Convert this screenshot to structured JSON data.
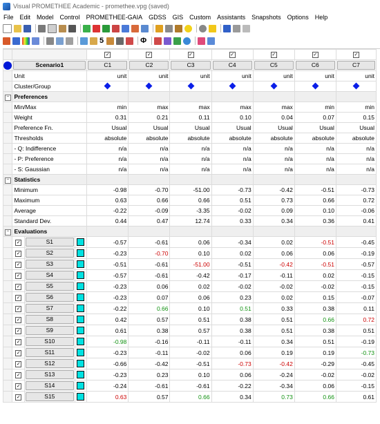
{
  "window": {
    "title": "Visual PROMETHEE Academic - promethee.vpg (saved)"
  },
  "menu": [
    "File",
    "Edit",
    "Model",
    "Control",
    "PROMETHEE-GAIA",
    "GDSS",
    "GIS",
    "Custom",
    "Assistants",
    "Snapshots",
    "Options",
    "Help"
  ],
  "toolbar": {
    "five_label": "5",
    "phi_label": "Φ"
  },
  "colors": {
    "criteria_color": "#0018d8",
    "action_color": "#00e2e2",
    "negative_text": "#cc0000",
    "positive_text": "#119111"
  },
  "grid": {
    "scenario": "Scenario1",
    "criteria": [
      "C1",
      "C2",
      "C3",
      "C4",
      "C5",
      "C6",
      "C7"
    ],
    "unit_row": {
      "label": "Unit",
      "values": [
        "unit",
        "unit",
        "unit",
        "unit",
        "unit",
        "unit",
        "unit"
      ]
    },
    "cluster_row": {
      "label": "Cluster/Group"
    },
    "sections": {
      "preferences": {
        "title": "Preferences",
        "rows": [
          {
            "label": "Min/Max",
            "values": [
              "min",
              "max",
              "max",
              "max",
              "max",
              "min",
              "min"
            ]
          },
          {
            "label": "Weight",
            "values": [
              "0.31",
              "0.21",
              "0.11",
              "0.10",
              "0.04",
              "0.07",
              "0.15"
            ]
          },
          {
            "label": "Preference Fn.",
            "values": [
              "Usual",
              "Usual",
              "Usual",
              "Usual",
              "Usual",
              "Usual",
              "Usual"
            ]
          },
          {
            "label": "Thresholds",
            "values": [
              "absolute",
              "absolute",
              "absolute",
              "absolute",
              "absolute",
              "absolute",
              "absolute"
            ]
          },
          {
            "label": "- Q: Indifference",
            "values": [
              "n/a",
              "n/a",
              "n/a",
              "n/a",
              "n/a",
              "n/a",
              "n/a"
            ]
          },
          {
            "label": "- P: Preference",
            "values": [
              "n/a",
              "n/a",
              "n/a",
              "n/a",
              "n/a",
              "n/a",
              "n/a"
            ]
          },
          {
            "label": "- S: Gaussian",
            "values": [
              "n/a",
              "n/a",
              "n/a",
              "n/a",
              "n/a",
              "n/a",
              "n/a"
            ]
          }
        ]
      },
      "statistics": {
        "title": "Statistics",
        "rows": [
          {
            "label": "Minimum",
            "values": [
              "-0.98",
              "-0.70",
              "-51.00",
              "-0.73",
              "-0.42",
              "-0.51",
              "-0.73"
            ]
          },
          {
            "label": "Maximum",
            "values": [
              "0.63",
              "0.66",
              "0.66",
              "0.51",
              "0.73",
              "0.66",
              "0.72"
            ]
          },
          {
            "label": "Average",
            "values": [
              "-0.22",
              "-0.09",
              "-3.35",
              "-0.02",
              "0.09",
              "0.10",
              "-0.06"
            ]
          },
          {
            "label": "Standard Dev.",
            "values": [
              "0.44",
              "0.47",
              "12.74",
              "0.33",
              "0.34",
              "0.36",
              "0.41"
            ]
          }
        ]
      },
      "evaluations": {
        "title": "Evaluations",
        "rows": [
          {
            "name": "S1",
            "values": [
              "-0.57",
              "-0.61",
              "0.06",
              "-0.34",
              "0.02",
              "-0.51",
              "-0.45"
            ],
            "colors": [
              "",
              "",
              "",
              "",
              "",
              "red",
              ""
            ]
          },
          {
            "name": "S2",
            "values": [
              "-0.23",
              "-0.70",
              "0.10",
              "0.02",
              "0.06",
              "0.06",
              "-0.19"
            ],
            "colors": [
              "",
              "red",
              "",
              "",
              "",
              "",
              ""
            ]
          },
          {
            "name": "S3",
            "values": [
              "-0.51",
              "-0.61",
              "-51.00",
              "-0.51",
              "-0.42",
              "-0.51",
              "-0.57"
            ],
            "colors": [
              "",
              "",
              "red",
              "",
              "red",
              "red",
              ""
            ]
          },
          {
            "name": "S4",
            "values": [
              "-0.57",
              "-0.61",
              "-0.42",
              "-0.17",
              "-0.11",
              "0.02",
              "-0.15"
            ],
            "colors": [
              "",
              "",
              "",
              "",
              "",
              "",
              ""
            ]
          },
          {
            "name": "S5",
            "values": [
              "-0.23",
              "0.06",
              "0.02",
              "-0.02",
              "-0.02",
              "-0.02",
              "-0.15"
            ],
            "colors": [
              "",
              "",
              "",
              "",
              "",
              "",
              ""
            ]
          },
          {
            "name": "S6",
            "values": [
              "-0.23",
              "0.07",
              "0.06",
              "0.23",
              "0.02",
              "0.15",
              "-0.07"
            ],
            "colors": [
              "",
              "",
              "",
              "",
              "",
              "",
              ""
            ]
          },
          {
            "name": "S7",
            "values": [
              "-0.22",
              "0.66",
              "0.10",
              "0.51",
              "0.33",
              "0.38",
              "0.11"
            ],
            "colors": [
              "",
              "green",
              "",
              "green",
              "",
              "",
              ""
            ]
          },
          {
            "name": "S8",
            "values": [
              "0.42",
              "0.57",
              "0.51",
              "0.38",
              "0.51",
              "0.66",
              "0.72"
            ],
            "colors": [
              "",
              "",
              "",
              "",
              "",
              "green",
              "red"
            ]
          },
          {
            "name": "S9",
            "values": [
              "0.61",
              "0.38",
              "0.57",
              "0.38",
              "0.51",
              "0.38",
              "0.51"
            ],
            "colors": [
              "",
              "",
              "",
              "",
              "",
              "",
              ""
            ]
          },
          {
            "name": "S10",
            "values": [
              "-0.98",
              "-0.16",
              "-0.11",
              "-0.11",
              "0.34",
              "0.51",
              "-0.19"
            ],
            "colors": [
              "green",
              "",
              "",
              "",
              "",
              "",
              ""
            ]
          },
          {
            "name": "S11",
            "values": [
              "-0.23",
              "-0.11",
              "-0.02",
              "0.06",
              "0.19",
              "0.19",
              "-0.73"
            ],
            "colors": [
              "",
              "",
              "",
              "",
              "",
              "",
              "green"
            ]
          },
          {
            "name": "S12",
            "values": [
              "-0.66",
              "-0.42",
              "-0.51",
              "-0.73",
              "-0.42",
              "-0.29",
              "-0.45"
            ],
            "colors": [
              "",
              "",
              "",
              "red",
              "red",
              "",
              ""
            ]
          },
          {
            "name": "S13",
            "values": [
              "-0.23",
              "0.23",
              "0.10",
              "0.06",
              "-0.24",
              "-0.02",
              "-0.02"
            ],
            "colors": [
              "",
              "",
              "",
              "",
              "",
              "",
              ""
            ]
          },
          {
            "name": "S14",
            "values": [
              "-0.24",
              "-0.61",
              "-0.61",
              "-0.22",
              "-0.34",
              "0.06",
              "-0.15"
            ],
            "colors": [
              "",
              "",
              "",
              "",
              "",
              "",
              ""
            ]
          },
          {
            "name": "S15",
            "values": [
              "0.63",
              "0.57",
              "0.66",
              "0.34",
              "0.73",
              "0.66",
              "0.61"
            ],
            "colors": [
              "red",
              "",
              "green",
              "",
              "green",
              "green",
              ""
            ]
          }
        ]
      }
    }
  }
}
